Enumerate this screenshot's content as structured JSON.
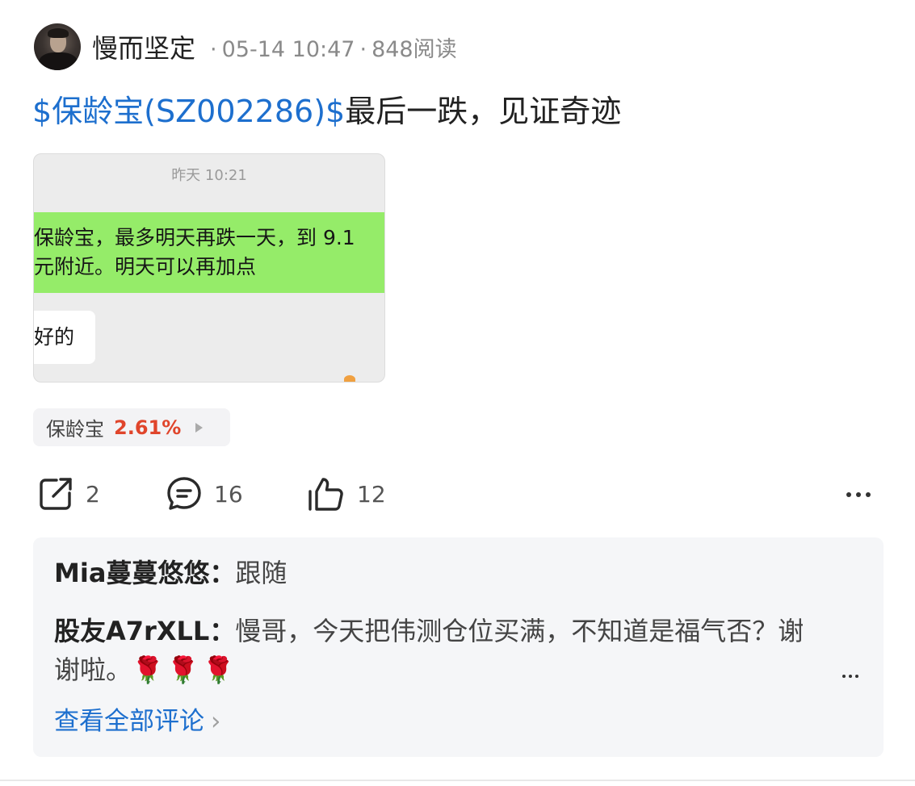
{
  "post": {
    "author": "慢而坚定",
    "separator": "·",
    "time": "05-14 10:47",
    "reads": "848阅读",
    "title_tag": "$保龄宝(SZ002286)$",
    "title_text": "最后一跌，见证奇迹"
  },
  "screenshot": {
    "time": "昨天 10:21",
    "message_line1": "保龄宝，最多明天再跌一天，到 9.1",
    "message_line2": "元附近。明天可以再加点",
    "reply": "好的"
  },
  "stock": {
    "name": "保龄宝",
    "change": "2.61%",
    "change_color": "#e0452b"
  },
  "actions": {
    "share_count": "2",
    "comment_count": "16",
    "like_count": "12"
  },
  "comments": [
    {
      "user": "Mia蔓蔓悠悠：",
      "text": "跟随"
    },
    {
      "user": "股友A7rXLL：",
      "text": "慢哥，今天把伟测仓位买满，不知道是福气否？谢谢啦。",
      "emoji": "🌹🌹🌹"
    }
  ],
  "view_all": "查看全部评论",
  "colors": {
    "link": "#1d6fce",
    "chat_green": "#95ec69"
  }
}
